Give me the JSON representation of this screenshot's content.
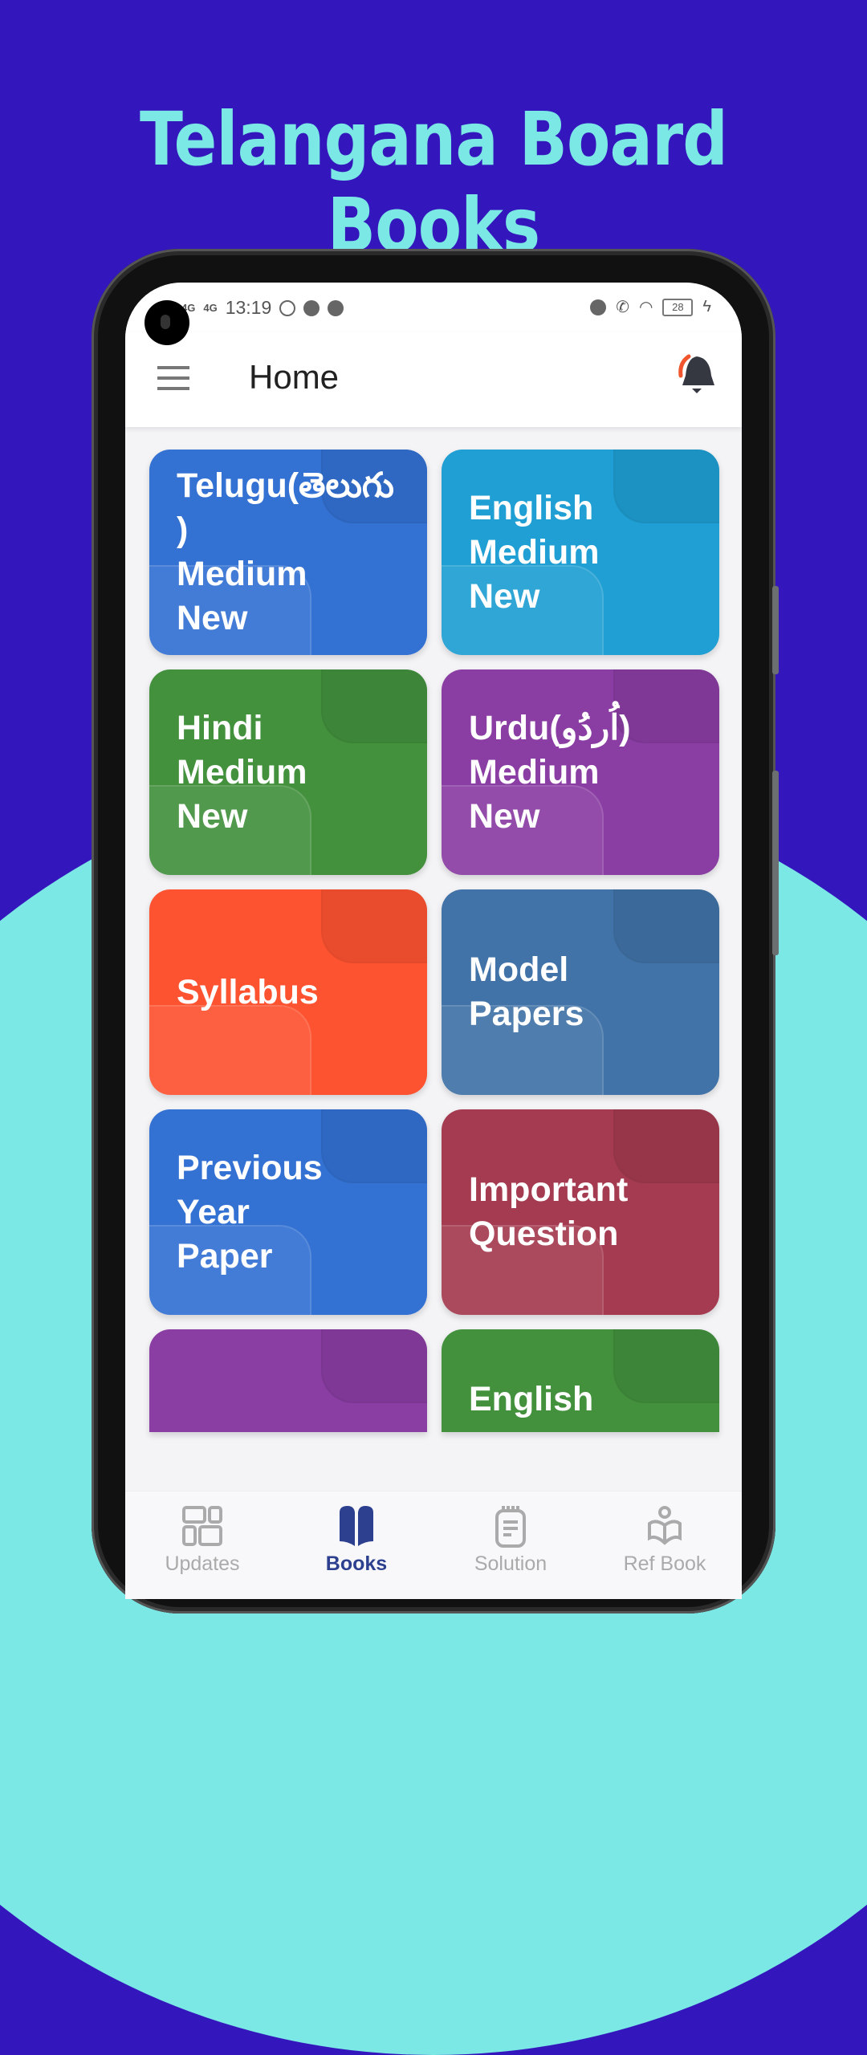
{
  "promo": {
    "title": "Telangana Board Books"
  },
  "status_bar": {
    "signal1": "4G",
    "signal2": "4G",
    "time": "13:19",
    "battery": "28"
  },
  "app_bar": {
    "title": "Home"
  },
  "tiles": [
    {
      "label": "Telugu(తెలుగు\n)\nMedium\nNew",
      "color": "#3371d3"
    },
    {
      "label": "English\nMedium\nNew",
      "color": "#1f9fd3"
    },
    {
      "label": "Hindi\nMedium\nNew",
      "color": "#43913d"
    },
    {
      "label": "Urdu(اُردُو)\nMedium\nNew",
      "color": "#8a3da3"
    },
    {
      "label": "Syllabus",
      "color": "#fd5330"
    },
    {
      "label": "Model\nPapers",
      "color": "#4173a8"
    },
    {
      "label": "Previous\nYear\nPaper",
      "color": "#3371d3"
    },
    {
      "label": "Important\nQuestion",
      "color": "#a43b50"
    },
    {
      "label": "",
      "color": "#8a3da3"
    },
    {
      "label": "English",
      "color": "#43913d"
    }
  ],
  "bottom_nav": [
    {
      "label": "Updates",
      "icon": "dashboard-icon",
      "active": false
    },
    {
      "label": "Books",
      "icon": "book-icon",
      "active": true
    },
    {
      "label": "Solution",
      "icon": "notepad-icon",
      "active": false
    },
    {
      "label": "Ref Book",
      "icon": "reader-icon",
      "active": false
    }
  ],
  "colors": {
    "background": "#3317bd",
    "accent_cyan": "#7be8e5",
    "nav_active": "#2d3f8f",
    "bell_accent": "#f0552e"
  }
}
